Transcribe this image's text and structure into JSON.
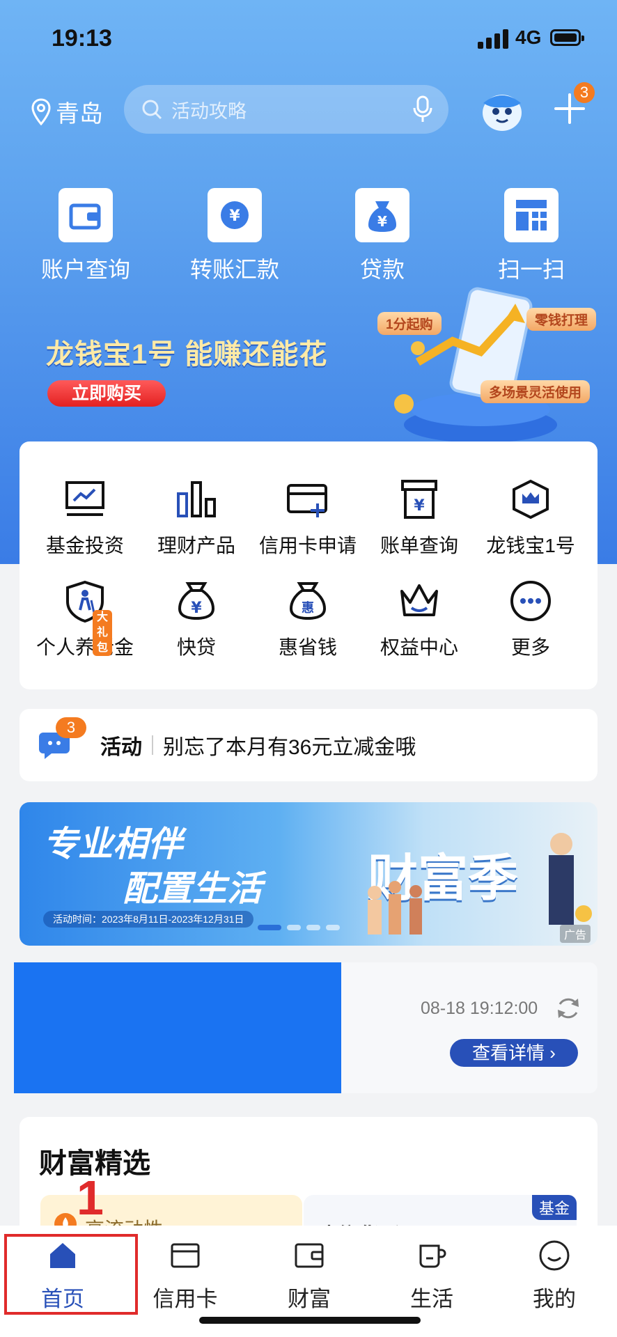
{
  "status": {
    "time": "19:13",
    "network": "4G"
  },
  "header": {
    "city": "青岛",
    "search_placeholder": "活动攻略",
    "plus_badge": "3"
  },
  "quick_actions": [
    {
      "label": "账户查询",
      "icon": "wallet-icon"
    },
    {
      "label": "转账汇款",
      "icon": "transfer-icon"
    },
    {
      "label": "贷款",
      "icon": "money-bag-icon"
    },
    {
      "label": "扫一扫",
      "icon": "scan-icon"
    }
  ],
  "hero_banner": {
    "title": "龙钱宝1号 能赚还能花",
    "cta": "立即购买",
    "tags": [
      "1分起购",
      "零钱打理",
      "多场景灵活使用"
    ]
  },
  "services": [
    {
      "label": "基金投资",
      "icon": "fund-chart-icon"
    },
    {
      "label": "理财产品",
      "icon": "bar-chart-icon"
    },
    {
      "label": "信用卡申请",
      "icon": "credit-card-add-icon"
    },
    {
      "label": "账单查询",
      "icon": "bill-icon"
    },
    {
      "label": "龙钱宝1号",
      "icon": "crown-shield-icon"
    },
    {
      "label": "个人养老金",
      "icon": "pension-icon",
      "badge": "大礼包"
    },
    {
      "label": "快贷",
      "icon": "money-bag-icon"
    },
    {
      "label": "惠省钱",
      "icon": "hui-bag-icon"
    },
    {
      "label": "权益中心",
      "icon": "crown-icon"
    },
    {
      "label": "更多",
      "icon": "more-icon"
    }
  ],
  "activity": {
    "badge": "3",
    "label": "活动",
    "text": "别忘了本月有36元立减金哦"
  },
  "promo": {
    "line1": "专业相伴",
    "line2": "配置生活",
    "date": "活动时间：2023年8月11日-2023年12月31日",
    "title": "财富季",
    "ad": "广告"
  },
  "info": {
    "timestamp": "08-18 19:12:00",
    "detail_button": "查看详情"
  },
  "wealth": {
    "title": "财富精选",
    "card1": "高流动性",
    "card2": "建信货币B",
    "card2_tag": "基金"
  },
  "annotation": {
    "number": "1"
  },
  "tabbar": [
    {
      "label": "首页",
      "icon": "home-icon",
      "active": true
    },
    {
      "label": "信用卡",
      "icon": "card-icon"
    },
    {
      "label": "财富",
      "icon": "wallet-icon"
    },
    {
      "label": "生活",
      "icon": "cup-icon"
    },
    {
      "label": "我的",
      "icon": "smile-icon"
    }
  ],
  "colors": {
    "primary": "#3a7ce6",
    "accent": "#f47b20",
    "active_tab": "#2850b8",
    "annotation": "#e02b2b"
  }
}
